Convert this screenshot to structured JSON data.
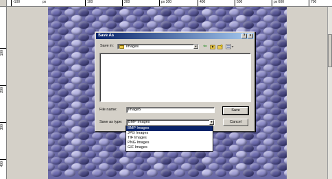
{
  "ruler": {
    "unit_label": "px",
    "ticks": [
      "-100",
      "px",
      "100",
      "200",
      "px 300",
      "400",
      "500",
      "px 600",
      "700"
    ],
    "vticks": [
      "100",
      "200",
      "300",
      "400"
    ]
  },
  "dialog": {
    "title": "Save As",
    "help_label": "?",
    "close_label": "×",
    "save_in_label": "Save in:",
    "save_in_value": "Images",
    "file_name_label": "File name:",
    "file_name_value": "Image5",
    "save_as_type_label": "Save as type:",
    "save_as_type_value": "BMP Images",
    "save_button": "Save",
    "cancel_button": "Cancel",
    "type_options": [
      "BMP Images",
      "JPG Images",
      "TIF Images",
      "PNG Images",
      "GIF Images"
    ],
    "selected_option_index": 0
  },
  "icons": {
    "back": "back-arrow-icon",
    "up": "up-folder-icon",
    "new_folder": "new-folder-icon",
    "views": "view-menu-icon"
  },
  "colors": {
    "titlebar_start": "#0a246a",
    "titlebar_end": "#a6caf0",
    "selection": "#0a246a"
  }
}
